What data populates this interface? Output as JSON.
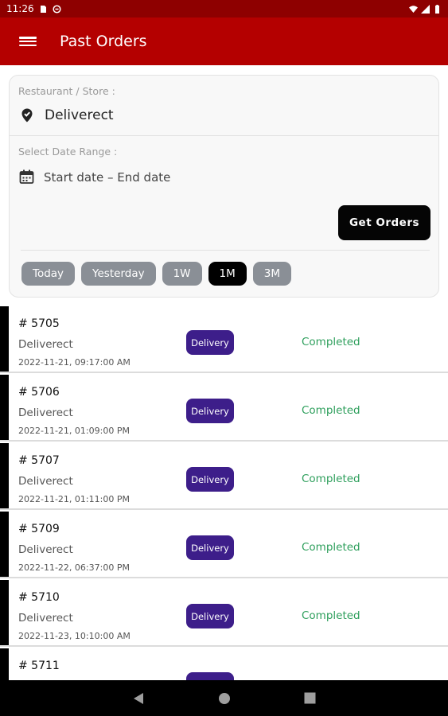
{
  "status_bar": {
    "time": "11:26"
  },
  "app_bar": {
    "title": "Past Orders"
  },
  "filters": {
    "store_label": "Restaurant / Store :",
    "store_value": "Deliverect",
    "date_label": "Select Date Range :",
    "date_value": "Start date – End date",
    "get_orders_label": "Get Orders",
    "chips": [
      {
        "label": "Today",
        "active": false
      },
      {
        "label": "Yesterday",
        "active": false
      },
      {
        "label": "1W",
        "active": false
      },
      {
        "label": "1M",
        "active": true
      },
      {
        "label": "3M",
        "active": false
      }
    ]
  },
  "orders": [
    {
      "id": "# 5705",
      "store": "Deliverect",
      "time": "2022-11-21, 09:17:00 AM",
      "type": "Delivery",
      "status": "Completed"
    },
    {
      "id": "# 5706",
      "store": "Deliverect",
      "time": "2022-11-21, 01:09:00 PM",
      "type": "Delivery",
      "status": "Completed"
    },
    {
      "id": "# 5707",
      "store": "Deliverect",
      "time": "2022-11-21, 01:11:00 PM",
      "type": "Delivery",
      "status": "Completed"
    },
    {
      "id": "# 5709",
      "store": "Deliverect",
      "time": "2022-11-22, 06:37:00 PM",
      "type": "Delivery",
      "status": "Completed"
    },
    {
      "id": "# 5710",
      "store": "Deliverect",
      "time": "2022-11-23, 10:10:00 AM",
      "type": "Delivery",
      "status": "Completed"
    },
    {
      "id": "# 5711",
      "store": "",
      "time": "",
      "type": "",
      "status": ""
    }
  ],
  "icons": {
    "menu": "menu-icon",
    "store": "store-pin-icon",
    "date": "calendar-icon",
    "back": "back-icon",
    "home": "home-icon",
    "recents": "recents-icon"
  },
  "colors": {
    "app_bar": "#b40000",
    "status_bar": "#8e0000",
    "badge": "#3d1e8a",
    "completed": "#2e9f5c",
    "chip": "#8a8f96",
    "chip_active": "#000000"
  }
}
